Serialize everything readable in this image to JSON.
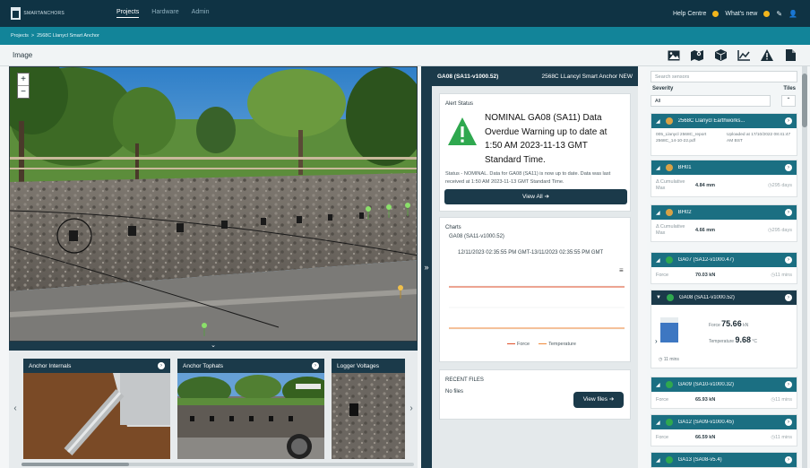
{
  "topbar": {
    "logo_text": "SMARTANCHORS",
    "nav": [
      "Projects",
      "Hardware",
      "Admin"
    ],
    "help": "Help Centre",
    "whats_new": "What's new"
  },
  "breadcrumb": [
    "Projects",
    ">",
    "2568C Llanycl Smart Anchor"
  ],
  "imagebar": {
    "title": "Image",
    "tools": [
      "image-icon",
      "map-icon",
      "cube-icon",
      "chart-line-icon",
      "warning-icon",
      "file-icon"
    ]
  },
  "scene": {
    "zoom_in": "+",
    "zoom_out": "−"
  },
  "carousel": {
    "toggle": "⌄",
    "cards": [
      "Anchor Internals",
      "Anchor Tophats",
      "Logger Voltages"
    ]
  },
  "detail": {
    "header_left": "GA08 (SA11-v1000.52)",
    "header_right": "2568C LLancyl Smart Anchor NEW",
    "alert": {
      "title": "Alert Status",
      "headline": "NOMINAL GA08 (SA11) Data Overdue Warning up to date at 1:50 AM 2023-11-13 GMT Standard Time.",
      "status": "Status - NOMINAL. Data for GA08 (SA11) is now up to date. Data was last received at 1:50 AM 2023-11-13 GMT Standard Time.",
      "view_all": "View All"
    },
    "charts": {
      "title": "Charts",
      "sensor": "GA08 (SA11-v1000.52)",
      "range": "12/11/2023 02:35:55 PM GMT-13/11/2023 02:35:55 PM GMT",
      "legend": [
        "Force",
        "Temperature"
      ],
      "colors": {
        "force": "#e0502a",
        "temperature": "#f08a3c"
      }
    },
    "files": {
      "title": "RECENT FILES",
      "empty": "No files",
      "button": "View files"
    }
  },
  "sensors": {
    "search_placeholder": "Search sensors",
    "severity_label": "Severity",
    "tiles_label": "Tiles",
    "severity_value": "All",
    "items": [
      {
        "name": "2568C Llanycl Earthworks...",
        "status": "amber",
        "file": "005_Llanycl 2568C_report 2568C_14-10-22.pdf",
        "meta": "Uploaded at 17/10/2022 08:41:47 AM BST"
      },
      {
        "name": "BH01",
        "status": "amber",
        "label": "Δ Cumulative Max",
        "value": "4.84 mm",
        "age": "295 days"
      },
      {
        "name": "BH02",
        "status": "amber",
        "label": "Δ Cumulative Max",
        "value": "4.66 mm",
        "age": "295 days"
      },
      {
        "name": "GA07 (SA12-v1000.47)",
        "status": "green",
        "label": "Force",
        "value": "70.03 kN",
        "age": "11 mins"
      },
      {
        "name": "GA08 (SA11-v1000.52)",
        "status": "green",
        "force_label": "Force",
        "force": "75.66",
        "force_unit": "kN",
        "temp_label": "Temperature",
        "temp": "9.68",
        "temp_unit": "°C",
        "age": "11 mins",
        "force_level": 0.78
      },
      {
        "name": "GA09 (SA10-v1000.32)",
        "status": "green",
        "label": "Force",
        "value": "65.93 kN",
        "age": "11 mins"
      },
      {
        "name": "GA12 (SA09-v1000.45)",
        "status": "green",
        "label": "Force",
        "value": "66.59 kN",
        "age": "11 mins"
      },
      {
        "name": "GA13 (SA08-v5.4)",
        "status": "green"
      }
    ]
  },
  "colors": {
    "navy": "#0f3344",
    "teal": "#128499",
    "card_head": "#1b6f82",
    "nominal": "#2fa84f",
    "amber": "#d7a246"
  }
}
